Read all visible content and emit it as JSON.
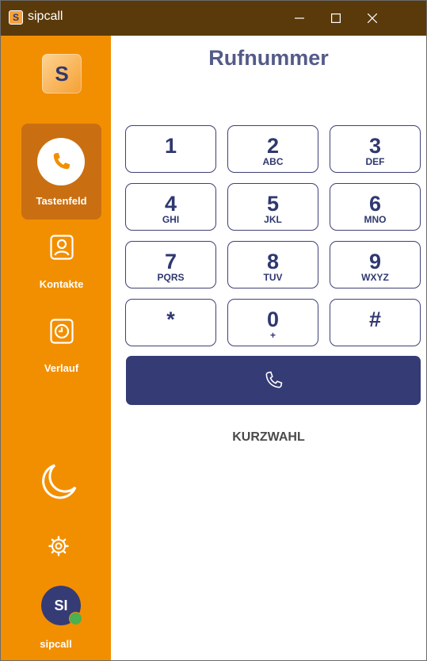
{
  "window": {
    "title": "sipcall",
    "app_icon_letter": "S"
  },
  "sidebar": {
    "logo_letter": "S",
    "nav": [
      {
        "label": "Tastenfeld",
        "icon": "phone-icon",
        "active": true
      },
      {
        "label": "Kontakte",
        "icon": "contact-icon",
        "active": false
      },
      {
        "label": "Verlauf",
        "icon": "clock-icon",
        "active": false
      }
    ],
    "theme_icon": "moon-icon",
    "settings_icon": "gear-icon",
    "user": {
      "initials": "SI",
      "name": "sipcall",
      "status_color": "#4caf50"
    }
  },
  "main": {
    "title": "Rufnummer",
    "keypad": [
      {
        "digit": "1",
        "letters": ""
      },
      {
        "digit": "2",
        "letters": "ABC"
      },
      {
        "digit": "3",
        "letters": "DEF"
      },
      {
        "digit": "4",
        "letters": "GHI"
      },
      {
        "digit": "5",
        "letters": "JKL"
      },
      {
        "digit": "6",
        "letters": "MNO"
      },
      {
        "digit": "7",
        "letters": "PQRS"
      },
      {
        "digit": "8",
        "letters": "TUV"
      },
      {
        "digit": "9",
        "letters": "WXYZ"
      },
      {
        "digit": "*",
        "letters": ""
      },
      {
        "digit": "0",
        "letters": "+"
      },
      {
        "digit": "#",
        "letters": ""
      }
    ],
    "call_icon": "phone-icon",
    "kurzwahl_label": "KURZWAHL"
  },
  "colors": {
    "sidebar": "#f28f00",
    "active_nav": "#c96f12",
    "accent": "#353b75",
    "titlebar": "#5a3a0b"
  }
}
